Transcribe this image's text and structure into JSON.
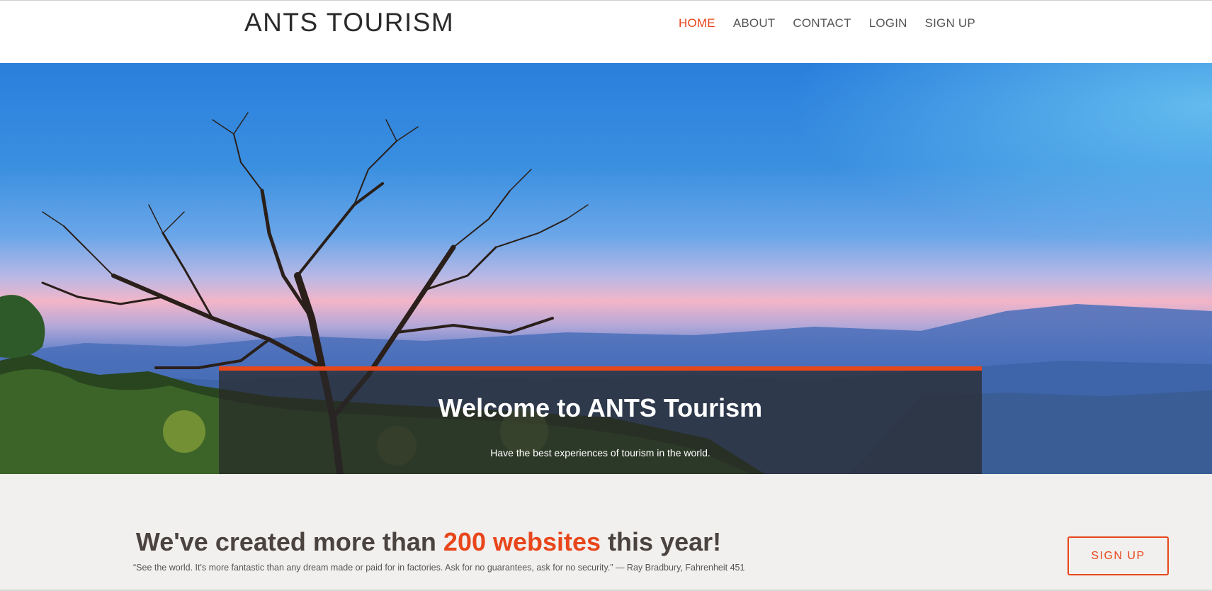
{
  "header": {
    "brand": "ANTS TOURISM",
    "nav": [
      "HOME",
      "ABOUT",
      "CONTACT",
      "LOGIN",
      "SIGN UP"
    ],
    "active_nav": "HOME"
  },
  "hero": {
    "title": "Welcome to ANTS Tourism",
    "subtitle": "Have the best experiences of tourism in the world."
  },
  "promo": {
    "heading_before": "We've created more than ",
    "heading_highlight": "200 websites",
    "heading_after": " this year!",
    "quote": "“See the world. It's more fantastic than any dream made or paid for in factories. Ask for no guarantees, ask for no security.” — Ray Bradbury, Fahrenheit 451",
    "button_label": "SIGN UP"
  },
  "colors": {
    "accent": "#e8461b",
    "text_dark": "#4a4340",
    "promo_bg": "#f2f0ee"
  }
}
